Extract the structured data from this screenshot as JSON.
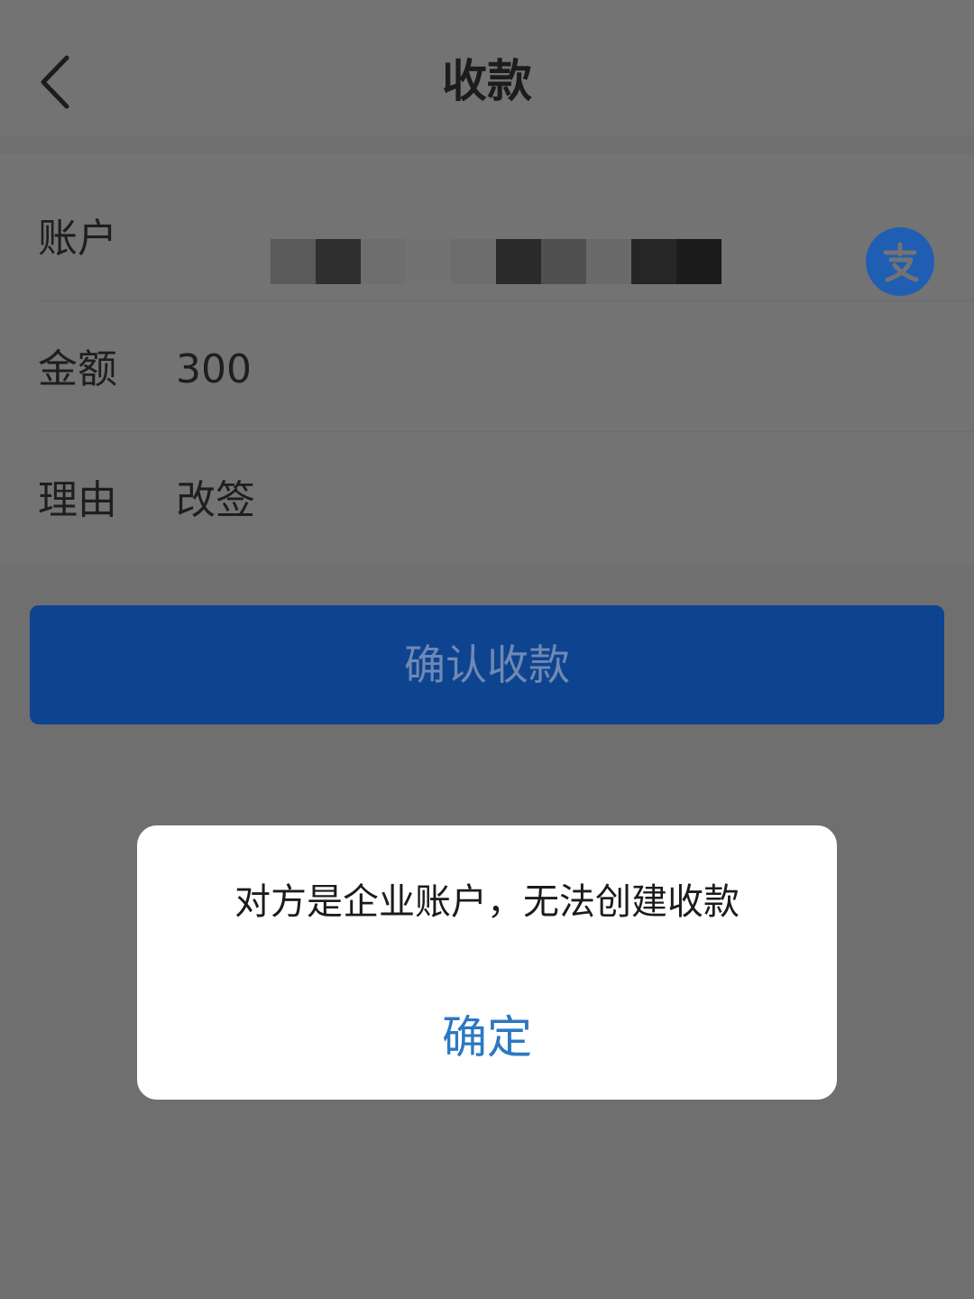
{
  "header": {
    "title": "收款",
    "back_icon": "chevron-left-icon"
  },
  "form": {
    "account": {
      "label": "账户",
      "value_redacted": true,
      "provider_icon": "alipay-icon"
    },
    "amount": {
      "label": "金额",
      "value": "300"
    },
    "reason": {
      "label": "理由",
      "value": "改签"
    }
  },
  "confirm_button": {
    "label": "确认收款"
  },
  "dialog": {
    "message": "对方是企业账户，无法创建收款",
    "ok_label": "确定"
  },
  "colors": {
    "overlay_gray": "#6f6f6f",
    "primary_blue": "#0e438f",
    "dialog_link_blue": "#2b78c4",
    "alipay_blue": "#1f5eb3"
  }
}
